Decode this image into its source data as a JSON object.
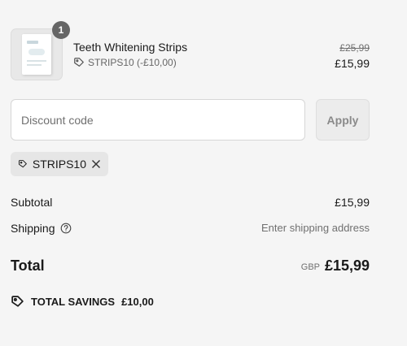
{
  "line_item": {
    "quantity": "1",
    "name": "Teeth Whitening Strips",
    "discount": "STRIPS10 (-£10,00)",
    "original_price": "£25,99",
    "price": "£15,99",
    "image_icon": "product-thumbnail"
  },
  "discount_form": {
    "placeholder": "Discount code",
    "value": "",
    "apply_label": "Apply"
  },
  "applied_code": {
    "code": "STRIPS10",
    "tag_icon": "tag-icon",
    "remove_icon": "close-icon"
  },
  "summary": {
    "subtotal_label": "Subtotal",
    "subtotal_value": "£15,99",
    "shipping_label": "Shipping",
    "shipping_value": "Enter shipping address",
    "total_label": "Total",
    "currency": "GBP",
    "total_value": "£15,99",
    "savings_label": "TOTAL SAVINGS",
    "savings_value": "£10,00"
  },
  "colors": {
    "background": "#f5f5f5",
    "text": "#1a1a1a",
    "muted": "#707070",
    "badge": "#666666"
  }
}
